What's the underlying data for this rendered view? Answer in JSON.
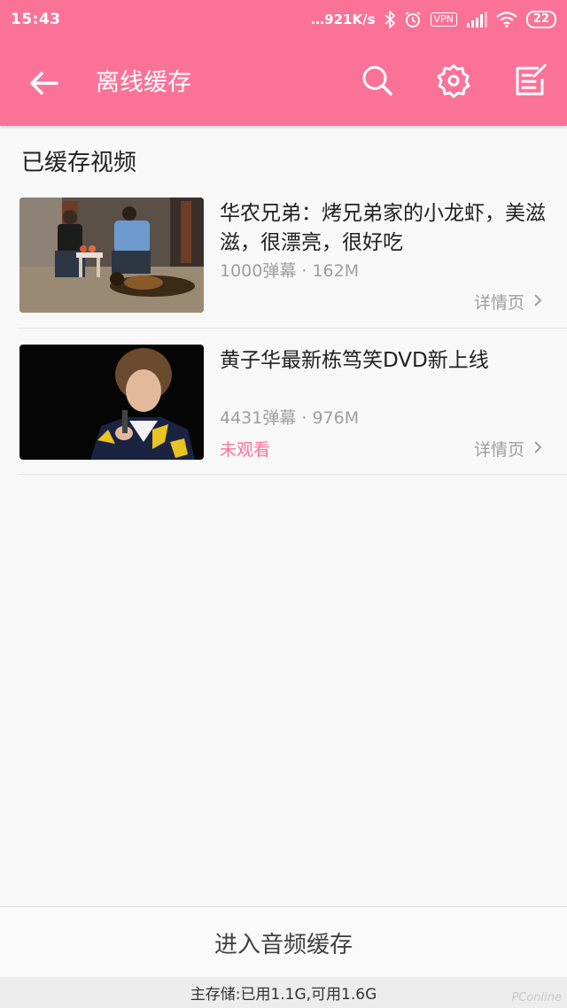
{
  "status_bar": {
    "time": "15:43",
    "net_speed": "…921K/s",
    "vpn": "VPN",
    "battery": "22"
  },
  "toolbar": {
    "title": "离线缓存",
    "icons": [
      "back-arrow-icon",
      "search-icon",
      "gear-icon",
      "edit-list-icon"
    ]
  },
  "section": {
    "title": "已缓存视频"
  },
  "videos": [
    {
      "title": "华农兄弟：烤兄弟家的小龙虾，美滋滋，很漂亮，很好吃",
      "meta": "1000弹幕 · 162M",
      "status": "",
      "detail": "详情页"
    },
    {
      "title": "黄子华最新栋笃笑DVD新上线",
      "meta": "4431弹幕 · 976M",
      "status": "未观看",
      "detail": "详情页"
    }
  ],
  "bottom": {
    "audio_button": "进入音频缓存",
    "storage": "主存储:已用1.1G,可用1.6G"
  },
  "watermark": "PConline",
  "colors": {
    "accent": "#fb7299",
    "text": "#212121",
    "secondary": "#9e9e9e"
  }
}
